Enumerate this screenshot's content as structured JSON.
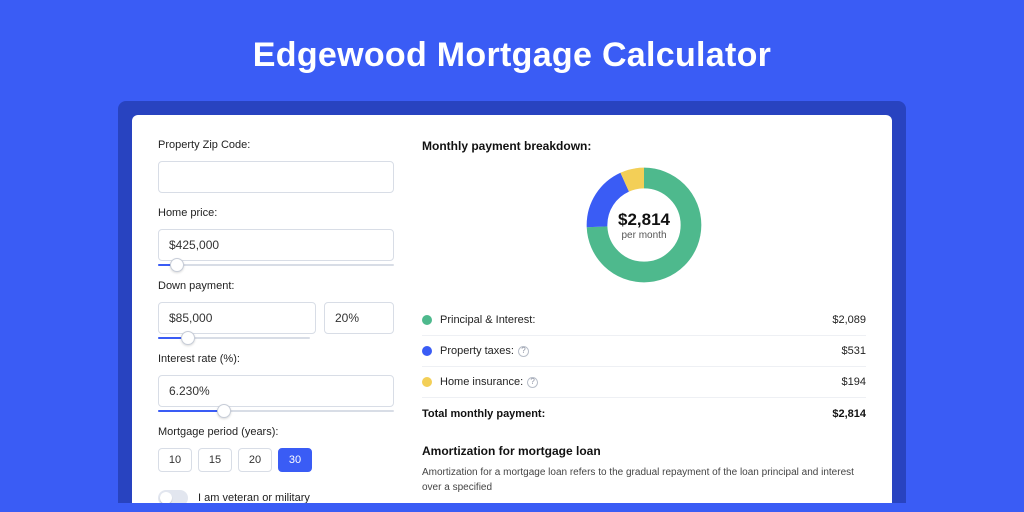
{
  "hero": {
    "title": "Edgewood Mortgage Calculator"
  },
  "form": {
    "zip_label": "Property Zip Code:",
    "zip_value": "",
    "home_price_label": "Home price:",
    "home_price_value": "$425,000",
    "home_price_slider_pct": 8,
    "down_payment_label": "Down payment:",
    "down_payment_value": "$85,000",
    "down_payment_pct_value": "20%",
    "down_payment_slider_pct": 20,
    "rate_label": "Interest rate (%):",
    "rate_value": "6.230%",
    "rate_slider_pct": 28,
    "period_label": "Mortgage period (years):",
    "periods": [
      "10",
      "15",
      "20",
      "30"
    ],
    "period_selected": "30",
    "veteran_label": "I am veteran or military"
  },
  "breakdown": {
    "title": "Monthly payment breakdown:",
    "center_amount": "$2,814",
    "center_sub": "per month",
    "rows": [
      {
        "label": "Principal & Interest:",
        "value": "$2,089",
        "color": "#4eb98d",
        "info": false
      },
      {
        "label": "Property taxes:",
        "value": "$531",
        "color": "#3a5cf5",
        "info": true
      },
      {
        "label": "Home insurance:",
        "value": "$194",
        "color": "#f3cf57",
        "info": true
      }
    ],
    "total_label": "Total monthly payment:",
    "total_value": "$2,814"
  },
  "chart_data": {
    "type": "pie",
    "title": "Monthly payment breakdown",
    "series": [
      {
        "name": "Principal & Interest",
        "value": 2089,
        "color": "#4eb98d"
      },
      {
        "name": "Property taxes",
        "value": 531,
        "color": "#3a5cf5"
      },
      {
        "name": "Home insurance",
        "value": 194,
        "color": "#f3cf57"
      }
    ],
    "total": 2814,
    "center_label": "$2,814 per month"
  },
  "amortization": {
    "title": "Amortization for mortgage loan",
    "text": "Amortization for a mortgage loan refers to the gradual repayment of the loan principal and interest over a specified"
  }
}
